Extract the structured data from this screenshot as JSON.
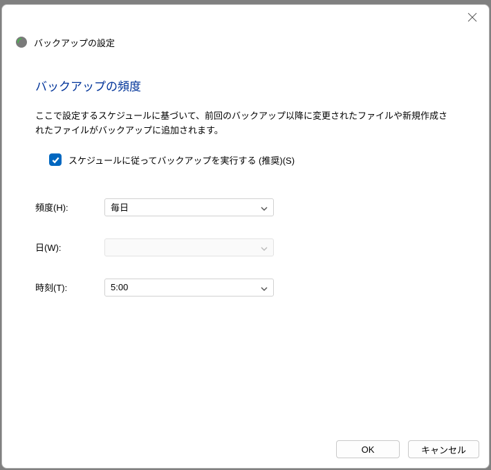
{
  "window": {
    "title": "バックアップの設定"
  },
  "heading": "バックアップの頻度",
  "description": "ここで設定するスケジュールに基づいて、前回のバックアップ以降に変更されたファイルや新規作成されたファイルがバックアップに追加されます。",
  "checkbox": {
    "checked": true,
    "label": "スケジュールに従ってバックアップを実行する (推奨)(S)"
  },
  "fields": {
    "frequency": {
      "label": "頻度(H):",
      "value": "毎日"
    },
    "day": {
      "label": "日(W):",
      "value": "",
      "disabled": true
    },
    "time": {
      "label": "時刻(T):",
      "value": "5:00"
    }
  },
  "buttons": {
    "ok": "OK",
    "cancel": "キャンセル"
  }
}
